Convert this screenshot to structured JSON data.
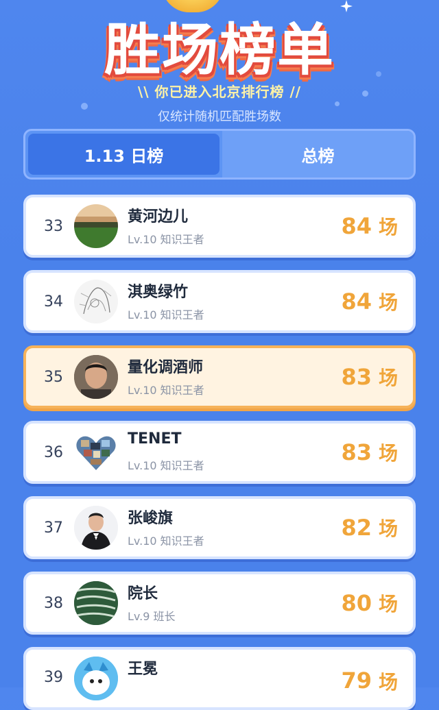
{
  "header": {
    "title": "胜场榜单",
    "subtitle": "\\\\ 你已进入北京排行榜 //",
    "note": "仅统计随机匹配胜场数"
  },
  "tabs": [
    {
      "label": "1.13 日榜",
      "active": true
    },
    {
      "label": "总榜",
      "active": false
    }
  ],
  "rows": [
    {
      "rank": "33",
      "name": "黄河边儿",
      "level": "Lv.10 知识王者",
      "wins": "84",
      "unit": "场",
      "avatar": "landscape-avatar"
    },
    {
      "rank": "34",
      "name": "淇奥绿竹",
      "level": "Lv.10 知识王者",
      "wins": "84",
      "unit": "场",
      "avatar": "sketch-avatar"
    },
    {
      "rank": "35",
      "name": "量化调酒师",
      "level": "Lv.10 知识王者",
      "wins": "83",
      "unit": "场",
      "avatar": "portrait-avatar",
      "highlight": true
    },
    {
      "rank": "36",
      "name": "TENET",
      "level": "Lv.10 知识王者",
      "wins": "83",
      "unit": "场",
      "avatar": "heart-collage-avatar"
    },
    {
      "rank": "37",
      "name": "张峻旗",
      "level": "Lv.10 知识王者",
      "wins": "82",
      "unit": "场",
      "avatar": "suit-avatar"
    },
    {
      "rank": "38",
      "name": "院长",
      "level": "Lv.9 班长",
      "wins": "80",
      "unit": "场",
      "avatar": "maze-avatar"
    },
    {
      "rank": "39",
      "name": "王冕",
      "level": "",
      "wins": "79",
      "unit": "场",
      "avatar": "cartoon-avatar"
    }
  ],
  "colors": {
    "background": "#4a82eb",
    "accent": "#f0a53a",
    "highlight_border": "#f6b25a"
  }
}
